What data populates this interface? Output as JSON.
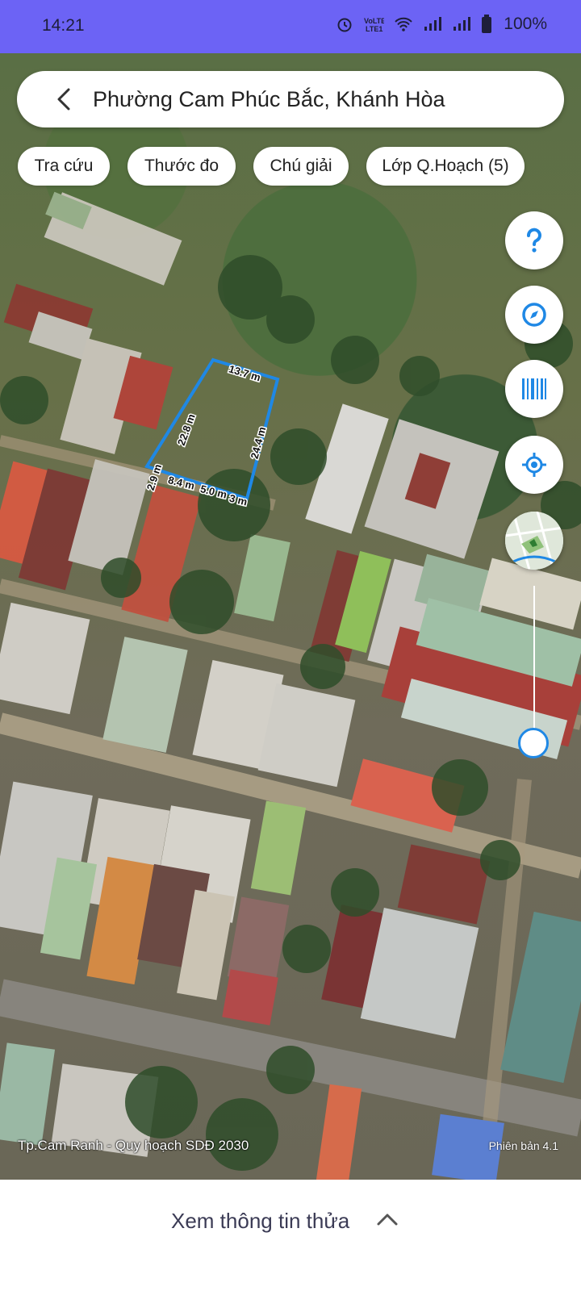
{
  "status_bar": {
    "time": "14:21",
    "battery": "100%"
  },
  "search": {
    "location": "Phường Cam Phúc Bắc, Khánh Hòa"
  },
  "chips": [
    {
      "label": "Tra cứu"
    },
    {
      "label": "Thước đo"
    },
    {
      "label": "Chú giải"
    },
    {
      "label": "Lớp Q.Hoạch (5)"
    }
  ],
  "fabs": [
    {
      "icon": "help-icon"
    },
    {
      "icon": "compass-icon"
    },
    {
      "icon": "barcode-icon"
    },
    {
      "icon": "my-location-icon"
    },
    {
      "icon": "minimap-icon"
    }
  ],
  "parcel": {
    "dimensions": [
      "13.7 m",
      "22.8 m",
      "24.4 m",
      "2.9 m",
      "8.4 m",
      "5.0 m",
      "3 m"
    ],
    "color": "#1f88e5"
  },
  "map": {
    "plan_caption": "Tp.Cam Ranh - Quy hoạch SDĐ 2030",
    "version": "Phiên bản 4.1"
  },
  "bottom_sheet": {
    "label": "Xem thông tin thửa"
  },
  "colors": {
    "status_bar": "#6c63f5",
    "accent": "#1f88e5"
  }
}
